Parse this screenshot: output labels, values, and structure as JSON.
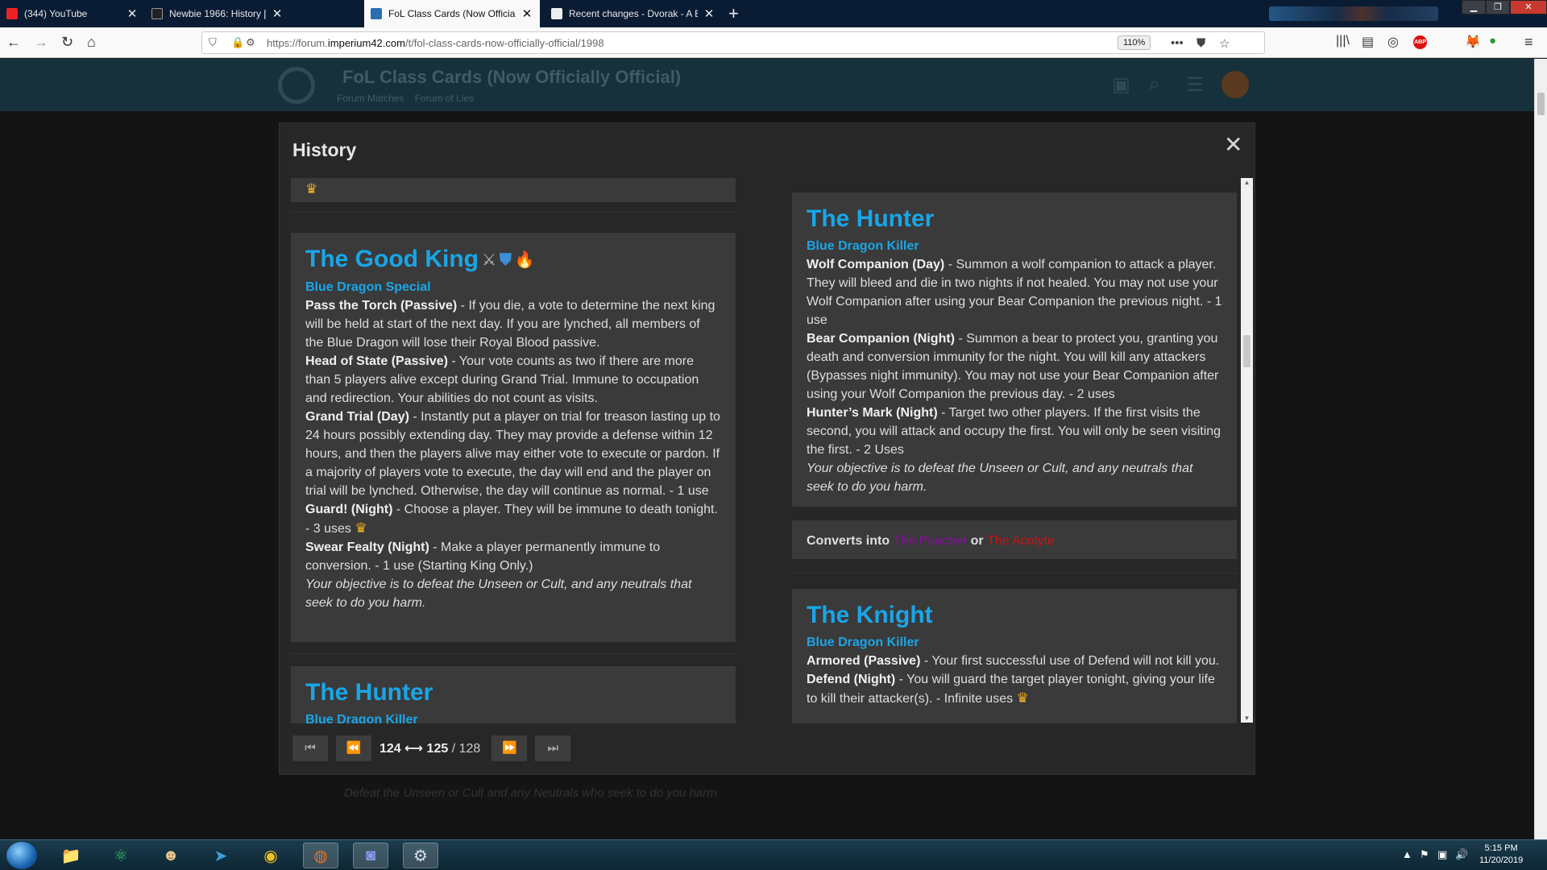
{
  "browser": {
    "tabs": [
      {
        "title": "(344) YouTube",
        "active": false
      },
      {
        "title": "Newbie 1966: History [Day 1] -",
        "active": false
      },
      {
        "title": "FoL Class Cards (Now Officially",
        "active": true
      },
      {
        "title": "Recent changes - Dvorak - A Bl",
        "active": false
      }
    ],
    "url_prefix": "https://forum.",
    "url_domain": "imperium42.com",
    "url_path": "/t/fol-class-cards-now-officially-official/1998",
    "zoom": "110%"
  },
  "background_page": {
    "topic_title": "FoL Class Cards (Now Officially Official)",
    "crumb_1": "Forum Matches",
    "crumb_2": "Forum of Lies",
    "footer_italic": "Defeat the Unseen or Cult and any Neutrals who seek to do you harm"
  },
  "modal": {
    "title": "History",
    "close_glyph": "✕",
    "left": {
      "good_king": {
        "name": "The Good King",
        "faction": "Blue Dragon Special",
        "abilities": [
          {
            "name": "Pass the Torch (Passive)",
            "text": " - If you die, a vote to determine the next king will be held at start of the next day. If you are lynched, all members of the Blue Dragon will lose their Royal Blood passive."
          },
          {
            "name": "Head of State (Passive)",
            "text": " - Your vote counts as two if there are more than 5 players alive except during Grand Trial. Immune to occupation and redirection. Your abilities do not count as visits."
          },
          {
            "name": "Grand Trial (Day)",
            "text": " - Instantly put a player on trial for treason lasting up to 24 hours possibly extending day. They may provide a defense within 12 hours, and then the players alive may either vote to execute or pardon. If a majority of players vote to execute, the day will end and the player on trial will be lynched. Otherwise, the day will continue as normal. - 1 use"
          },
          {
            "name": "Guard! (Night)",
            "text": " - Choose a player. They will be immune to death tonight. - 3 uses"
          },
          {
            "name": "Swear Fealty (Night)",
            "text": " - Make a player permanently immune to conversion. - 1 use (Starting King Only.)"
          }
        ],
        "objective": "Your objective is to defeat the Unseen or Cult, and any neutrals that seek to do you harm."
      },
      "hunter_peek": {
        "name": "The Hunter",
        "faction": "Blue Dragon Killer"
      }
    },
    "right": {
      "hunter": {
        "name": "The Hunter",
        "faction": "Blue Dragon Killer",
        "abilities": [
          {
            "name": "Wolf Companion (Day)",
            "text": " - Summon a wolf companion to attack a player. They will bleed and die in two nights if not healed. You may not use your Wolf Companion after using your Bear Companion the previous night. - 1 use"
          },
          {
            "name": "Bear Companion (Night)",
            "text": " - Summon a bear to protect you, granting you death and conversion immunity for the night. You will kill any attackers (Bypasses night immunity). You may not use your Bear Companion after using your Wolf Companion the previous day. - 2 uses"
          },
          {
            "name": "Hunter’s Mark (Night)",
            "text": " - Target two other players. If the first visits the second, you will attack and occupy the first. You will only be seen visiting the first. - 2 Uses"
          }
        ],
        "objective": "Your objective is to defeat the Unseen or Cult, and any neutrals that seek to do you harm."
      },
      "converts": {
        "label": "Converts into",
        "option_a": "The Poacher",
        "joiner": "or",
        "option_b": "The Acolyte"
      },
      "knight": {
        "name": "The Knight",
        "faction": "Blue Dragon Killer",
        "abilities": [
          {
            "name": "Armored (Passive)",
            "text": " - Your first successful use of Defend will not kill you."
          },
          {
            "name": "Defend (Night)",
            "text": " - You will guard the target player tonight, giving your life to kill their attacker(s). - Infinite uses"
          }
        ]
      }
    },
    "pager": {
      "from": "124",
      "arrow": "⟷",
      "to": "125",
      "sep": " / ",
      "total": "128"
    }
  },
  "taskbar": {
    "time": "5:15 PM",
    "date": "11/20/2019"
  },
  "colors": {
    "accent_blue": "#19a6e8",
    "poacher_purple": "#8a0ea0",
    "acolyte_red": "#c81414",
    "crown_gold": "#f0b323"
  }
}
